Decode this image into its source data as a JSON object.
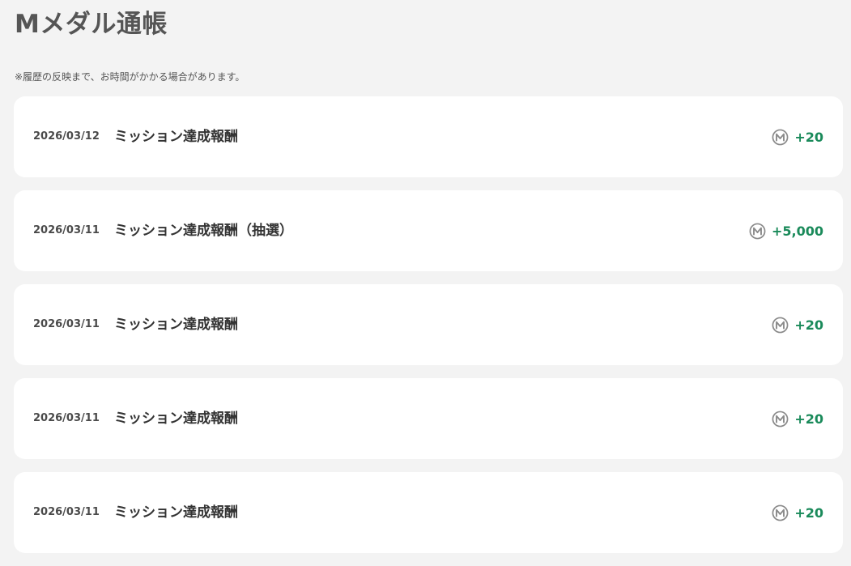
{
  "page": {
    "title": "Mメダル通帳",
    "notice": "※履歴の反映まで、お時間がかかる場合があります。"
  },
  "colors": {
    "background": "#f3f3f3",
    "card": "#ffffff",
    "amount_positive": "#1a8a5a",
    "medal_icon": "#8a8a8a"
  },
  "history": [
    {
      "date": "2026/03/12",
      "title": "ミッション達成報酬",
      "amount": "+20",
      "icon": "medal-icon"
    },
    {
      "date": "2026/03/11",
      "title": "ミッション達成報酬（抽選）",
      "amount": "+5,000",
      "icon": "medal-icon"
    },
    {
      "date": "2026/03/11",
      "title": "ミッション達成報酬",
      "amount": "+20",
      "icon": "medal-icon"
    },
    {
      "date": "2026/03/11",
      "title": "ミッション達成報酬",
      "amount": "+20",
      "icon": "medal-icon"
    },
    {
      "date": "2026/03/11",
      "title": "ミッション達成報酬",
      "amount": "+20",
      "icon": "medal-icon"
    }
  ]
}
